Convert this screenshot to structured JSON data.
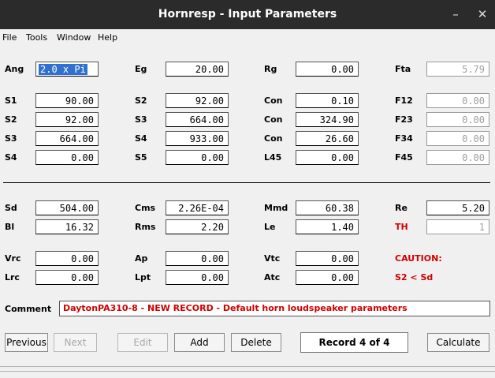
{
  "window": {
    "title": "Hornresp - Input Parameters",
    "minimize": "–",
    "close": "✕"
  },
  "menu": {
    "file": "File",
    "tools": "Tools",
    "window": "Window",
    "help": "Help"
  },
  "rows": {
    "ang": {
      "l1": "Ang",
      "v1": "2.0 x Pi",
      "l2": "Eg",
      "v2": "20.00",
      "l3": "Rg",
      "v3": "0.00",
      "l4": "Fta",
      "v4": "5.79"
    },
    "s1": {
      "l1": "S1",
      "v1": "90.00",
      "l2": "S2",
      "v2": "92.00",
      "l3": "Con",
      "v3": "0.10",
      "l4": "F12",
      "v4": "0.00"
    },
    "s2": {
      "l1": "S2",
      "v1": "92.00",
      "l2": "S3",
      "v2": "664.00",
      "l3": "Con",
      "v3": "324.90",
      "l4": "F23",
      "v4": "0.00"
    },
    "s3": {
      "l1": "S3",
      "v1": "664.00",
      "l2": "S4",
      "v2": "933.00",
      "l3": "Con",
      "v3": "26.60",
      "l4": "F34",
      "v4": "0.00"
    },
    "s4": {
      "l1": "S4",
      "v1": "0.00",
      "l2": "S5",
      "v2": "0.00",
      "l3": "L45",
      "v3": "0.00",
      "l4": "F45",
      "v4": "0.00"
    },
    "sd": {
      "l1": "Sd",
      "v1": "504.00",
      "l2": "Cms",
      "v2": "2.26E-04",
      "l3": "Mmd",
      "v3": "60.38",
      "l4": "Re",
      "v4": "5.20"
    },
    "bl": {
      "l1": "Bl",
      "v1": "16.32",
      "l2": "Rms",
      "v2": "2.20",
      "l3": "Le",
      "v3": "1.40",
      "l4": "TH",
      "v4": "1"
    },
    "vrc": {
      "l1": "Vrc",
      "v1": "0.00",
      "l2": "Ap",
      "v2": "0.00",
      "l3": "Vtc",
      "v3": "0.00",
      "l4": "CAUTION:"
    },
    "lrc": {
      "l1": "Lrc",
      "v1": "0.00",
      "l2": "Lpt",
      "v2": "0.00",
      "l3": "Atc",
      "v3": "0.00",
      "l4": "S2 < Sd"
    }
  },
  "comment": {
    "label": "Comment",
    "value": "DaytonPA310-8 - NEW RECORD - Default horn loudspeaker parameters"
  },
  "buttons": {
    "previous": "Previous",
    "next": "Next",
    "edit": "Edit",
    "add": "Add",
    "delete": "Delete",
    "calculate": "Calculate"
  },
  "record": "Record 4 of 4",
  "colors": {
    "titlebar": "#2b2b2b",
    "warning": "#d00000",
    "selection": "#3070d0"
  }
}
